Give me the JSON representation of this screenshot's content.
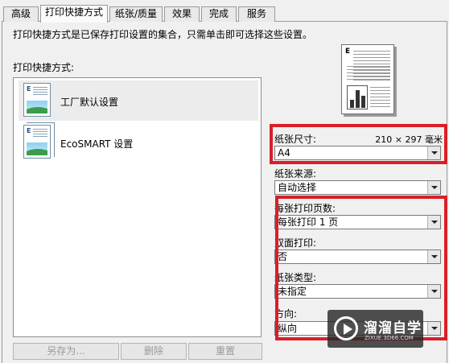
{
  "tabs": [
    {
      "label": "高级"
    },
    {
      "label": "打印快捷方式"
    },
    {
      "label": "纸张/质量"
    },
    {
      "label": "效果"
    },
    {
      "label": "完成"
    },
    {
      "label": "服务"
    }
  ],
  "description": "打印快捷方式是已保存打印设置的集合，只需单击即可选择这些设置。",
  "shortcuts": {
    "label": "打印快捷方式:",
    "items": [
      {
        "label": "工厂默认设置",
        "icon": "document-icon",
        "selected": true
      },
      {
        "label": "EcoSMART 设置",
        "icon": "document-stack-icon",
        "selected": false
      }
    ]
  },
  "buttons": {
    "save_as": "另存为...",
    "delete": "删除",
    "reset": "重置"
  },
  "settings": {
    "paper_size": {
      "label": "纸张尺寸:",
      "dimensions": "210 × 297 毫米",
      "value": "A4"
    },
    "paper_source": {
      "label": "纸张来源:",
      "value": "自动选择"
    },
    "pages_per_sheet": {
      "label": "每张打印页数:",
      "value": "每张打印 1 页"
    },
    "duplex": {
      "label": "双面打印:",
      "value": "否"
    },
    "paper_type": {
      "label": "纸张类型:",
      "value": "未指定"
    },
    "orientation": {
      "label": "方向:",
      "value": "纵向"
    }
  },
  "highlight_color": "#d81f27",
  "watermark": {
    "title": "溜溜自学",
    "url": "ZIXUE.3D66.COM"
  }
}
